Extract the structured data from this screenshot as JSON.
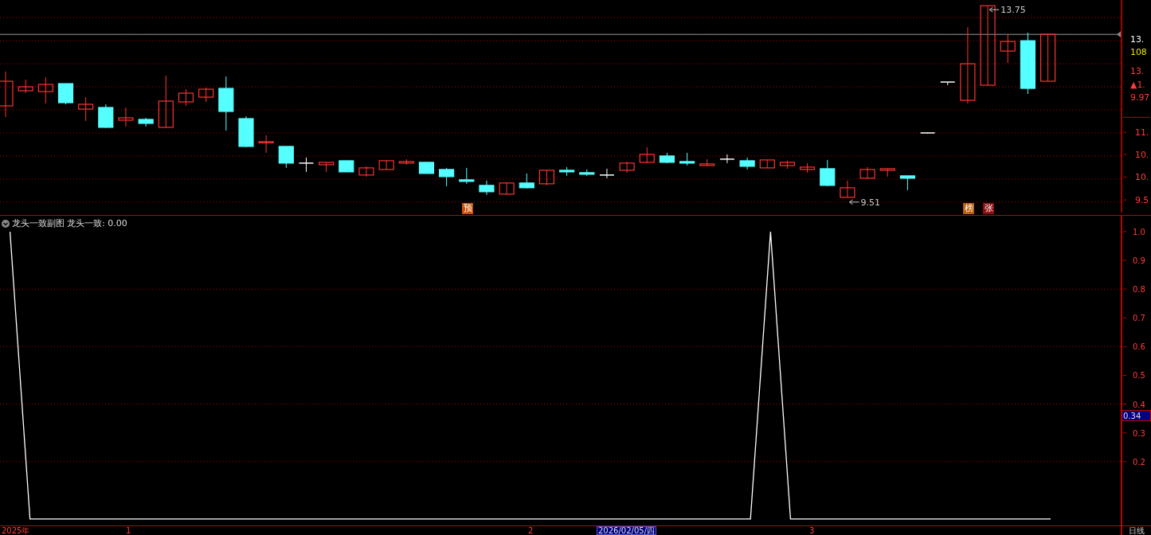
{
  "price_pane": {
    "annotations": [
      {
        "text": "13.75",
        "kind": "high"
      },
      {
        "text": "9.51",
        "kind": "low"
      }
    ],
    "badges": [
      {
        "text": "预",
        "kind": "forecast"
      },
      {
        "text": "榜",
        "kind": "list"
      },
      {
        "text": "张",
        "kind": "limit"
      }
    ],
    "axis": {
      "quotes": [
        {
          "text": "13.",
          "kind": "price"
        },
        {
          "text": "108",
          "kind": "volume"
        },
        {
          "text": "13.",
          "kind": "up"
        },
        {
          "text": "▲1.",
          "kind": "up"
        },
        {
          "text": "9.97",
          "kind": "up"
        }
      ],
      "ticks": [
        "11.",
        "10.",
        "10.",
        "9.5"
      ]
    }
  },
  "indicator_pane": {
    "title": "龙头一致副图",
    "legend_value": ": 0.00",
    "cursor_value": "0.34",
    "chart_data": {
      "type": "line",
      "categories": [
        null,
        null,
        null,
        null,
        null,
        null,
        null,
        null,
        null,
        null,
        null,
        null,
        null,
        null,
        null,
        null,
        null,
        null,
        null,
        null,
        null,
        null,
        null,
        null,
        null,
        null,
        null,
        null,
        null,
        null,
        null,
        null,
        null,
        null,
        null,
        null,
        null,
        null,
        null,
        null,
        null,
        null,
        null,
        null,
        null,
        null,
        null,
        null,
        null,
        null,
        null,
        null,
        null,
        null,
        null,
        null
      ],
      "grid": true,
      "ylim": [
        -0.022,
        1.055
      ],
      "series": [
        {
          "name": "龙头一致",
          "color": "#ffffff",
          "values": [
            1,
            0,
            0,
            0,
            0,
            0,
            0,
            0,
            0,
            0,
            0,
            0,
            0,
            0,
            0,
            0,
            0,
            0,
            0,
            0,
            0,
            0,
            0,
            0,
            0,
            0,
            0,
            0,
            0,
            0,
            0,
            0,
            0,
            0,
            0,
            0,
            0,
            0,
            1,
            0,
            0,
            0,
            0,
            0,
            0,
            0,
            0,
            0,
            0,
            0,
            0,
            0,
            0,
            null,
            null,
            null
          ]
        }
      ],
      "yticks": [
        {
          "value": 1,
          "label": "1.0"
        },
        {
          "value": 0.9,
          "label": "0.9"
        },
        {
          "value": 0.8,
          "label": "0.8"
        },
        {
          "value": 0.7,
          "label": "0.7"
        },
        {
          "value": 0.6,
          "label": "0.6"
        },
        {
          "value": 0.5,
          "label": "0.5"
        },
        {
          "value": 0.4,
          "label": "0.4"
        },
        {
          "value": 0.3,
          "label": "0.3"
        },
        {
          "value": 0.2,
          "label": "0.2"
        }
      ]
    }
  },
  "time_axis": {
    "labels": [
      "2025年",
      "1",
      "2",
      "3"
    ],
    "cursor_date": "2026/02/05/四",
    "period": "日线"
  }
}
